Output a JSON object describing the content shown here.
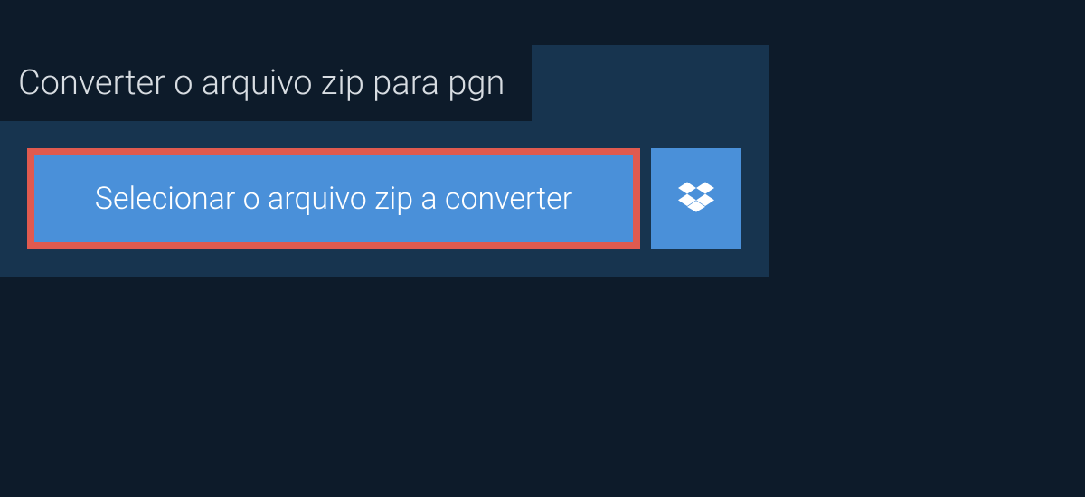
{
  "header": {
    "title": "Converter o arquivo zip para pgn"
  },
  "actions": {
    "select_label": "Selecionar o arquivo zip a converter",
    "dropbox_icon": "dropbox"
  },
  "colors": {
    "background": "#0d1b2a",
    "panel": "#17344f",
    "button": "#4a90d9",
    "highlight_border": "#e05a4f",
    "text_light": "#ffffff",
    "text_muted": "#d8dde2"
  }
}
